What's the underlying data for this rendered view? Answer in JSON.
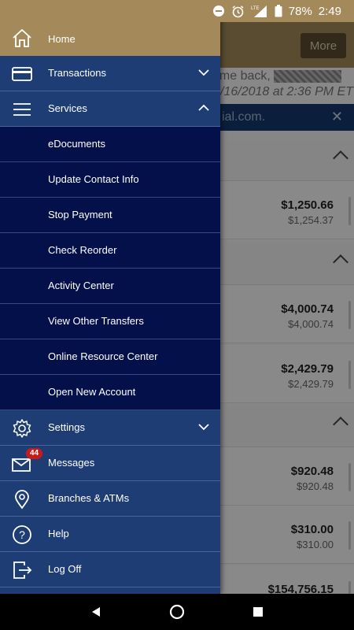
{
  "status_bar": {
    "network": "LTE",
    "battery": "78%",
    "time": "2:49"
  },
  "background": {
    "more_label": "More",
    "welcome_text": "ome back,",
    "last_login": "/16/2018 at 2:36 PM ET",
    "notice_text": "ial.com.",
    "accounts": [
      {
        "amount": "$1,250.66",
        "available": "$1,254.37"
      },
      {
        "amount": "$4,000.74",
        "available": "$4,000.74"
      },
      {
        "amount": "$2,429.79",
        "available": "$2,429.79"
      },
      {
        "amount": "$920.48",
        "available": "$920.48"
      },
      {
        "amount": "$310.00",
        "available": "$310.00"
      },
      {
        "amount": "$154,756.15",
        "available": ""
      }
    ]
  },
  "drawer": {
    "home": {
      "label": "Home",
      "icon": "home-icon"
    },
    "transactions": {
      "label": "Transactions",
      "icon": "card-icon"
    },
    "services": {
      "label": "Services",
      "icon": "menu-icon",
      "items": [
        "eDocuments",
        "Update Contact Info",
        "Stop Payment",
        "Check Reorder",
        "Activity Center",
        "View Other Transfers",
        "Online Resource Center",
        "Open New Account"
      ]
    },
    "settings": {
      "label": "Settings",
      "icon": "gear-icon"
    },
    "messages": {
      "label": "Messages",
      "icon": "mail-icon",
      "badge": "44"
    },
    "branches": {
      "label": "Branches & ATMs",
      "icon": "location-pin-icon"
    },
    "help": {
      "label": "Help",
      "icon": "help-icon"
    },
    "logoff": {
      "label": "Log Off",
      "icon": "logout-icon"
    }
  },
  "colors": {
    "header_gold": "#a48a5a",
    "drawer_blue": "#1e3d75",
    "submenu_navy": "#03104a",
    "badge_red": "#c41b1b"
  }
}
